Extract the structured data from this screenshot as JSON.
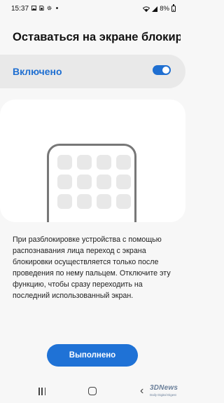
{
  "status_bar": {
    "time": "15:37",
    "left_icons": [
      "gallery-icon",
      "sim-card-icon",
      "settings-gear-icon",
      "dot-icon"
    ],
    "right_icons": [
      "wifi-icon",
      "signal-icon",
      "battery-icon"
    ],
    "battery_percent": "8%"
  },
  "page": {
    "title": "Оставаться на экране блокир…"
  },
  "toggle": {
    "label": "Включено",
    "state": "on",
    "accent_color": "#1f6fd1"
  },
  "illustration": {
    "tiles": 12
  },
  "description": "При разблокировке устройства с помощью распознавания лица переход с экрана блокировки осуществляется только после проведения по нему пальцем. Отключите эту функцию, чтобы сразу переходить на последний использованный экран.",
  "done_button": {
    "label": "Выполнено"
  },
  "nav_bar": {
    "icons": [
      "recent-apps-icon",
      "home-icon",
      "back-icon"
    ]
  },
  "watermark": {
    "logo": "3DNews",
    "tagline": "Daily Digital Digest"
  }
}
